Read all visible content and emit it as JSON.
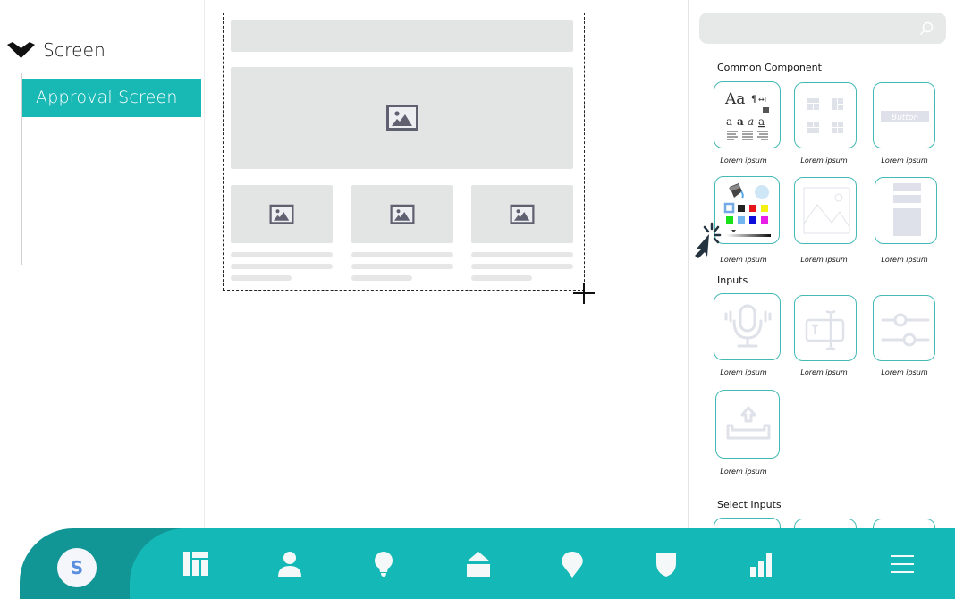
{
  "tree": {
    "root_label": "Screen",
    "root_icon": "chevron-down-icon",
    "children": [
      {
        "label": "Approval Screen",
        "selected": true
      }
    ]
  },
  "canvas": {
    "selection_icon": "crosshair-cursor-icon",
    "placeholder_image_icon": "image-icon"
  },
  "panel": {
    "search": {
      "value": "",
      "placeholder": "",
      "icon": "search-icon"
    },
    "sections": [
      {
        "title": "Common Component",
        "items": [
          {
            "label": "Lorem ipsum",
            "icon": "typography-icon"
          },
          {
            "label": "Lorem ipsum",
            "icon": "layout-grid-icon"
          },
          {
            "label": "Lorem ipsum",
            "icon": "button-icon",
            "icon_text": "Button"
          },
          {
            "label": "Lorem ipsum",
            "icon": "color-palette-icon"
          },
          {
            "label": "Lorem ipsum",
            "icon": "image-placeholder-icon"
          },
          {
            "label": "Lorem ipsum",
            "icon": "form-layout-icon"
          }
        ]
      },
      {
        "title": "Inputs",
        "items": [
          {
            "label": "Lorem ipsum",
            "icon": "microphone-icon"
          },
          {
            "label": "Lorem ipsum",
            "icon": "text-input-icon"
          },
          {
            "label": "Lorem ipsum",
            "icon": "slider-icon"
          },
          {
            "label": "Lorem ipsum",
            "icon": "upload-icon"
          }
        ]
      },
      {
        "title": "Select Inputs",
        "items": []
      }
    ],
    "palette_colors": [
      "#ffffff",
      "#222222",
      "#e8141b",
      "#f4f00f",
      "#19e21b",
      "#74b6f0",
      "#0d0ddb",
      "#e81ee6"
    ]
  },
  "nav": {
    "avatar_letter": "S",
    "items": [
      {
        "name": "dashboard",
        "icon": "dashboard-icon"
      },
      {
        "name": "users",
        "icon": "user-icon"
      },
      {
        "name": "ideas",
        "icon": "lightbulb-icon"
      },
      {
        "name": "home",
        "icon": "home-icon"
      },
      {
        "name": "location",
        "icon": "map-pin-icon"
      },
      {
        "name": "security",
        "icon": "shield-icon"
      },
      {
        "name": "analytics",
        "icon": "bar-chart-icon"
      },
      {
        "name": "menu",
        "icon": "hamburger-menu-icon"
      }
    ]
  }
}
